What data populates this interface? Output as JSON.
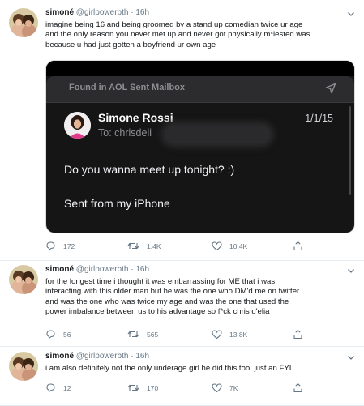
{
  "tweets": [
    {
      "name": "simoné",
      "handle": "@girlpowerbth",
      "dot": "·",
      "time": "16h",
      "lines": [
        "imagine being 16 and being groomed by a stand up comedian twice ur age",
        "and the only reason you never met up and never got physically m*lested was",
        "because u had just gotten a boyfriend ur own age"
      ],
      "replies": "172",
      "retweets": "1.4K",
      "likes": "10.4K"
    },
    {
      "name": "simoné",
      "handle": "@girlpowerbth",
      "dot": "·",
      "time": "16h",
      "lines": [
        "for the longest time i thought it was embarrassing for ME that i was",
        "interacting with this older man but he was the one who DM'd me on twitter",
        "and was the one who was twice my age and was the one that used the",
        "power imbalance between us to his advantage so f*ck chris d'elia"
      ],
      "replies": "56",
      "retweets": "565",
      "likes": "13.8K"
    },
    {
      "name": "simoné",
      "handle": "@girlpowerbth",
      "dot": "·",
      "time": "16h",
      "lines": [
        "i am also definitely not the only underage girl he did this too. just an FYI."
      ],
      "replies": "12",
      "retweets": "170",
      "likes": "7K"
    }
  ],
  "email": {
    "mailbox": "Found in AOL Sent Mailbox",
    "sender": "Simone Rossi",
    "to": "To: chrisdeli",
    "date": "1/1/15",
    "message": "Do you wanna meet up tonight? :)",
    "signature": "Sent from my iPhone"
  },
  "colors": {
    "text": "#14171a",
    "secondary": "#657786",
    "divider": "#e6ecf0",
    "email_bg": "#151515"
  },
  "icons": [
    "chevron-down-icon",
    "reply-icon",
    "retweet-icon",
    "like-icon",
    "share-icon",
    "send-icon"
  ]
}
